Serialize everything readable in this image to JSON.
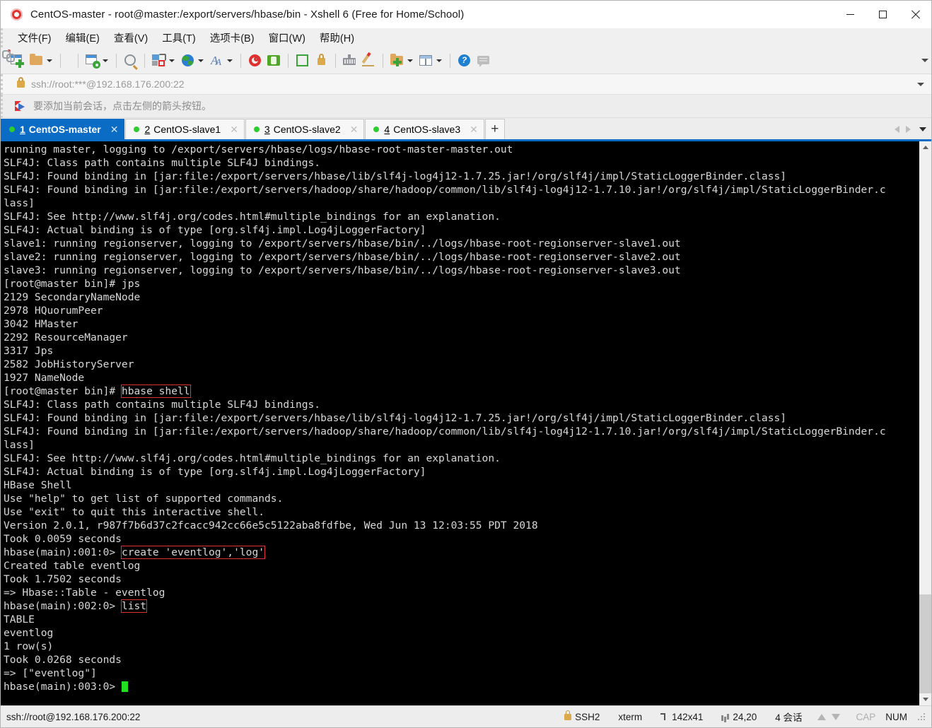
{
  "window": {
    "title": "CentOS-master - root@master:/export/servers/hbase/bin - Xshell 6 (Free for Home/School)",
    "app_icon": "xshell-icon",
    "minimize_label": "─",
    "maximize_label": "□",
    "close_label": "✕"
  },
  "menu": {
    "items": [
      {
        "label": "文件(F)",
        "name": "menu-file"
      },
      {
        "label": "编辑(E)",
        "name": "menu-edit"
      },
      {
        "label": "查看(V)",
        "name": "menu-view"
      },
      {
        "label": "工具(T)",
        "name": "menu-tools"
      },
      {
        "label": "选项卡(B)",
        "name": "menu-tabs"
      },
      {
        "label": "窗口(W)",
        "name": "menu-window"
      },
      {
        "label": "帮助(H)",
        "name": "menu-help"
      }
    ]
  },
  "toolbar": {
    "icons": [
      "new-session-icon",
      "open-folder-icon",
      "disconnect-icon",
      "link-icon",
      "session-properties-icon",
      "find-icon",
      "transfer-icon",
      "web-browser-icon",
      "font-icon",
      "swirl-icon",
      "green-box-icon",
      "fullscreen-icon",
      "lock-icon",
      "keyboard-icon",
      "highlight-pen-icon",
      "new-folder-icon",
      "split-panes-icon",
      "help-icon",
      "comment-icon"
    ],
    "overflow_label": "▼"
  },
  "address": {
    "value": "ssh://root:***@192.168.176.200:22",
    "lock_icon": "lock-icon",
    "dropdown_label": "▼"
  },
  "infobar": {
    "icon": "red-flag-icon",
    "text": "要添加当前会话，点击左侧的箭头按钮。"
  },
  "tabs": {
    "items": [
      {
        "num": "1",
        "label": "CentOS-master",
        "active": true,
        "status": "connected",
        "close": "✕"
      },
      {
        "num": "2",
        "label": "CentOS-slave1",
        "active": false,
        "status": "connected",
        "close": "✕"
      },
      {
        "num": "3",
        "label": "CentOS-slave2",
        "active": false,
        "status": "connected",
        "close": "✕"
      },
      {
        "num": "4",
        "label": "CentOS-slave3",
        "active": false,
        "status": "connected",
        "close": "✕"
      }
    ],
    "add_label": "+",
    "nav_prev": "◀",
    "nav_next": "▶",
    "nav_list": "▼"
  },
  "terminal": {
    "lines": [
      {
        "text": "running master, logging to /export/servers/hbase/logs/hbase-root-master-master.out"
      },
      {
        "text": "SLF4J: Class path contains multiple SLF4J bindings."
      },
      {
        "text": "SLF4J: Found binding in [jar:file:/export/servers/hbase/lib/slf4j-log4j12-1.7.25.jar!/org/slf4j/impl/StaticLoggerBinder.class]"
      },
      {
        "text": "SLF4J: Found binding in [jar:file:/export/servers/hadoop/share/hadoop/common/lib/slf4j-log4j12-1.7.10.jar!/org/slf4j/impl/StaticLoggerBinder.c"
      },
      {
        "text": "lass]"
      },
      {
        "text": "SLF4J: See http://www.slf4j.org/codes.html#multiple_bindings for an explanation."
      },
      {
        "text": "SLF4J: Actual binding is of type [org.slf4j.impl.Log4jLoggerFactory]"
      },
      {
        "text": "slave1: running regionserver, logging to /export/servers/hbase/bin/../logs/hbase-root-regionserver-slave1.out"
      },
      {
        "text": "slave2: running regionserver, logging to /export/servers/hbase/bin/../logs/hbase-root-regionserver-slave2.out"
      },
      {
        "text": "slave3: running regionserver, logging to /export/servers/hbase/bin/../logs/hbase-root-regionserver-slave3.out"
      },
      {
        "text": "[root@master bin]# jps"
      },
      {
        "text": "2129 SecondaryNameNode"
      },
      {
        "text": "2978 HQuorumPeer"
      },
      {
        "text": "3042 HMaster"
      },
      {
        "text": "2292 ResourceManager"
      },
      {
        "text": "3317 Jps"
      },
      {
        "text": "2582 JobHistoryServer"
      },
      {
        "text": "1927 NameNode"
      },
      {
        "prefix": "[root@master bin]# ",
        "highlight": "hbase shell"
      },
      {
        "text": "SLF4J: Class path contains multiple SLF4J bindings."
      },
      {
        "text": "SLF4J: Found binding in [jar:file:/export/servers/hbase/lib/slf4j-log4j12-1.7.25.jar!/org/slf4j/impl/StaticLoggerBinder.class]"
      },
      {
        "text": "SLF4J: Found binding in [jar:file:/export/servers/hadoop/share/hadoop/common/lib/slf4j-log4j12-1.7.10.jar!/org/slf4j/impl/StaticLoggerBinder.c"
      },
      {
        "text": "lass]"
      },
      {
        "text": "SLF4J: See http://www.slf4j.org/codes.html#multiple_bindings for an explanation."
      },
      {
        "text": "SLF4J: Actual binding is of type [org.slf4j.impl.Log4jLoggerFactory]"
      },
      {
        "text": "HBase Shell"
      },
      {
        "text": "Use \"help\" to get list of supported commands."
      },
      {
        "text": "Use \"exit\" to quit this interactive shell."
      },
      {
        "text": "Version 2.0.1, r987f7b6d37c2fcacc942cc66e5c5122aba8fdfbe, Wed Jun 13 12:03:55 PDT 2018"
      },
      {
        "text": "Took 0.0059 seconds"
      },
      {
        "prefix": "hbase(main):001:0> ",
        "highlight": "create 'eventlog','log'"
      },
      {
        "text": "Created table eventlog"
      },
      {
        "text": "Took 1.7502 seconds"
      },
      {
        "text": "=> Hbase::Table - eventlog"
      },
      {
        "prefix": "hbase(main):002:0> ",
        "highlight": "list"
      },
      {
        "text": "TABLE"
      },
      {
        "text": "eventlog"
      },
      {
        "text": "1 row(s)"
      },
      {
        "text": "Took 0.0268 seconds"
      },
      {
        "text": "=> [\"eventlog\"]"
      },
      {
        "prefix": "hbase(main):003:0> ",
        "cursor": true
      }
    ],
    "colors": {
      "background": "#000000",
      "foreground": "#d8d8d8",
      "cursor": "#20e020",
      "highlight_border": "#e03131"
    }
  },
  "statusbar": {
    "connection": "ssh://root@192.168.176.200:22",
    "protocol": "SSH2",
    "terminal_type": "xterm",
    "size": "142x41",
    "position": "24,20",
    "sessions": "4 会话",
    "cap": "CAP",
    "num": "NUM"
  }
}
